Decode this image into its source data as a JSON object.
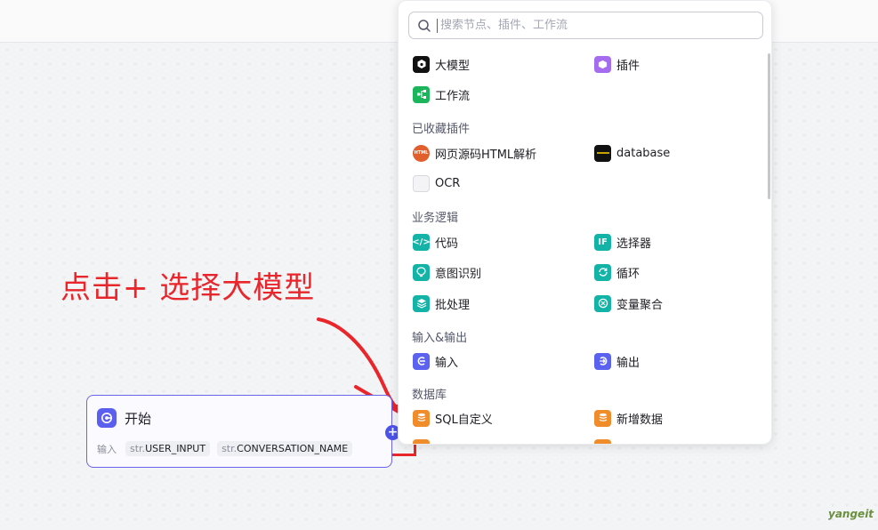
{
  "annotation": {
    "text": "点击+ 选择大模型"
  },
  "start_node": {
    "title": "开始",
    "inputs_label": "输入",
    "params": [
      {
        "type": "str.",
        "name": "USER_INPUT"
      },
      {
        "type": "str.",
        "name": "CONVERSATION_NAME"
      }
    ],
    "add_symbol": "+"
  },
  "panel": {
    "search_placeholder": "搜索节点、插件、工作流",
    "top_items": [
      {
        "label": "大模型",
        "icon": "llm-icon"
      },
      {
        "label": "插件",
        "icon": "plugin-icon"
      },
      {
        "label": "工作流",
        "icon": "workflow-icon"
      }
    ],
    "sections": [
      {
        "title": "已收藏插件",
        "items": [
          {
            "label": "网页源码HTML解析",
            "icon": "html-parse-icon"
          },
          {
            "label": "database",
            "icon": "database-plugin-icon"
          },
          {
            "label": "OCR",
            "icon": "ocr-icon"
          }
        ]
      },
      {
        "title": "业务逻辑",
        "items": [
          {
            "label": "代码",
            "icon": "code-icon"
          },
          {
            "label": "选择器",
            "icon": "selector-icon"
          },
          {
            "label": "意图识别",
            "icon": "intent-icon"
          },
          {
            "label": "循环",
            "icon": "loop-icon"
          },
          {
            "label": "批处理",
            "icon": "batch-icon"
          },
          {
            "label": "变量聚合",
            "icon": "variable-merge-icon"
          }
        ]
      },
      {
        "title": "输入&输出",
        "items": [
          {
            "label": "输入",
            "icon": "input-icon"
          },
          {
            "label": "输出",
            "icon": "output-icon"
          }
        ]
      },
      {
        "title": "数据库",
        "items": [
          {
            "label": "SQL自定义",
            "icon": "sql-icon"
          },
          {
            "label": "新增数据",
            "icon": "add-data-icon"
          }
        ]
      }
    ]
  },
  "watermark": "yangeit",
  "colors": {
    "accent": "#4d53e8",
    "annotation": "#e8262b",
    "teal": "#13b3a7",
    "orange": "#f08c2a"
  }
}
